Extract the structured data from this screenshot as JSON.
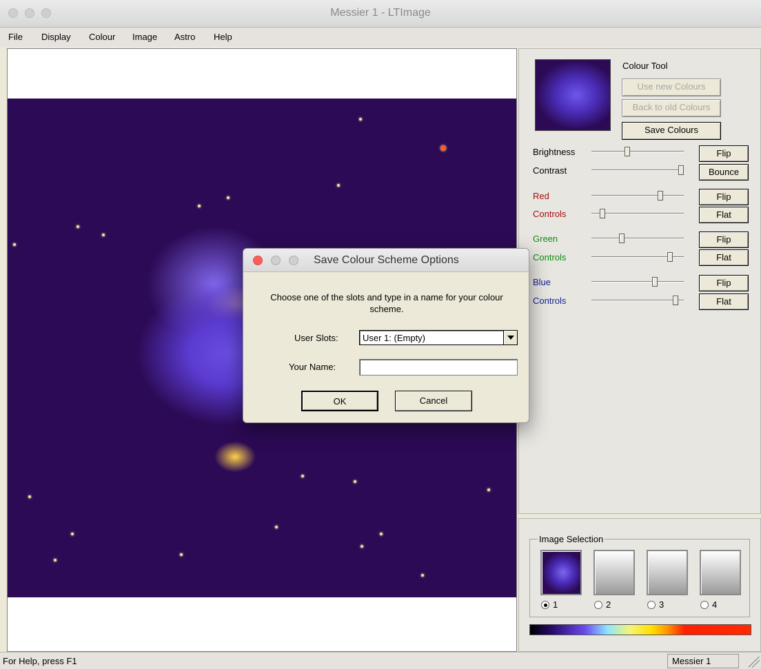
{
  "window": {
    "title": "Messier 1 - LTImage"
  },
  "menu": [
    "File",
    "Display",
    "Colour",
    "Image",
    "Astro",
    "Help"
  ],
  "colour_tool": {
    "title": "Colour Tool",
    "use_new": "Use new Colours",
    "back_old": "Back to old Colours",
    "save": "Save Colours"
  },
  "controls": {
    "brightness": "Brightness",
    "contrast": "Contrast",
    "red": "Red",
    "red_controls": "Controls",
    "green": "Green",
    "green_controls": "Controls",
    "blue": "Blue",
    "blue_controls": "Controls",
    "flip": "Flip",
    "bounce": "Bounce",
    "flat": "Flat",
    "colors": {
      "red": "#a01010",
      "green": "#128a12",
      "blue": "#14209a"
    }
  },
  "image_selection": {
    "title": "Image Selection",
    "slots": [
      "1",
      "2",
      "3",
      "4"
    ],
    "selected": "1"
  },
  "status": {
    "help": "For Help, press F1",
    "image": "Messier 1"
  },
  "dialog": {
    "title": "Save Colour Scheme Options",
    "message": "Choose one of the slots and type in a name for your colour scheme.",
    "user_slots_label": "User Slots:",
    "user_slots_value": "User 1: (Empty)",
    "your_name_label": "Your Name:",
    "your_name_value": "",
    "ok": "OK",
    "cancel": "Cancel"
  }
}
